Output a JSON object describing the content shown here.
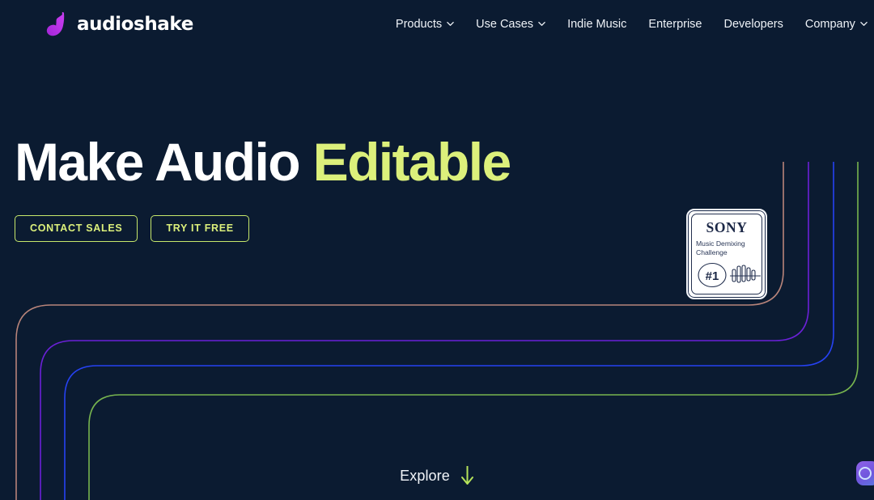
{
  "theme": {
    "background": "#0b1b31",
    "accent_green": "#dcf07b",
    "logo_purple": "#b02ee0",
    "text_white": "#ffffff"
  },
  "header": {
    "brand": {
      "name": "audioshake",
      "mark_icon": "audioshake-note-icon"
    },
    "nav": [
      {
        "label": "Products",
        "has_dropdown": true,
        "icon": "chevron-down-icon"
      },
      {
        "label": "Use Cases",
        "has_dropdown": true,
        "icon": "chevron-down-icon"
      },
      {
        "label": "Indie Music",
        "has_dropdown": false,
        "icon": ""
      },
      {
        "label": "Enterprise",
        "has_dropdown": false,
        "icon": ""
      },
      {
        "label": "Developers",
        "has_dropdown": false,
        "icon": ""
      },
      {
        "label": "Company",
        "has_dropdown": true,
        "icon": "chevron-down-icon"
      }
    ]
  },
  "hero": {
    "headline_lead": "Make Audio ",
    "headline_accent": "Editable",
    "buttons": [
      {
        "label": "CONTACT SALES"
      },
      {
        "label": "TRY IT FREE"
      }
    ]
  },
  "badge": {
    "brand": "SONY",
    "line1": "Music Demixing",
    "line2": "Challenge",
    "rank": "#1",
    "waveform_icon": "waveform-icon"
  },
  "explore": {
    "label": "Explore",
    "icon": "arrow-down-icon"
  },
  "chat": {
    "icon": "chat-bubble-icon",
    "label": ""
  },
  "decoration": {
    "lines": [
      {
        "name": "salmon",
        "color": "#b8847a"
      },
      {
        "name": "purple",
        "color": "#6b21d8"
      },
      {
        "name": "blue",
        "color": "#2642f2"
      },
      {
        "name": "green",
        "color": "#77b44f"
      }
    ]
  }
}
